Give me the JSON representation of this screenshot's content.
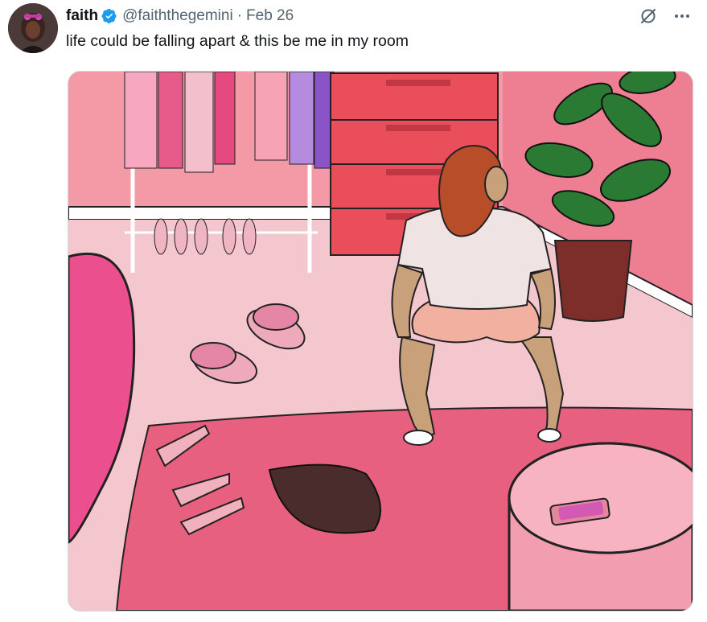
{
  "author": {
    "display_name": "faith",
    "handle": "@faiththegemini",
    "verified": true,
    "avatar_icon": "profile-photo"
  },
  "separator": "·",
  "date": "Feb 26",
  "tweet_text": "life could be falling apart & this be me in my room",
  "actions": {
    "grok_icon": "grok-icon",
    "more_icon": "more-options-icon"
  },
  "colors": {
    "verified_blue": "#1d9bf0",
    "secondary_text": "#536471",
    "primary_text": "#0f1419"
  }
}
